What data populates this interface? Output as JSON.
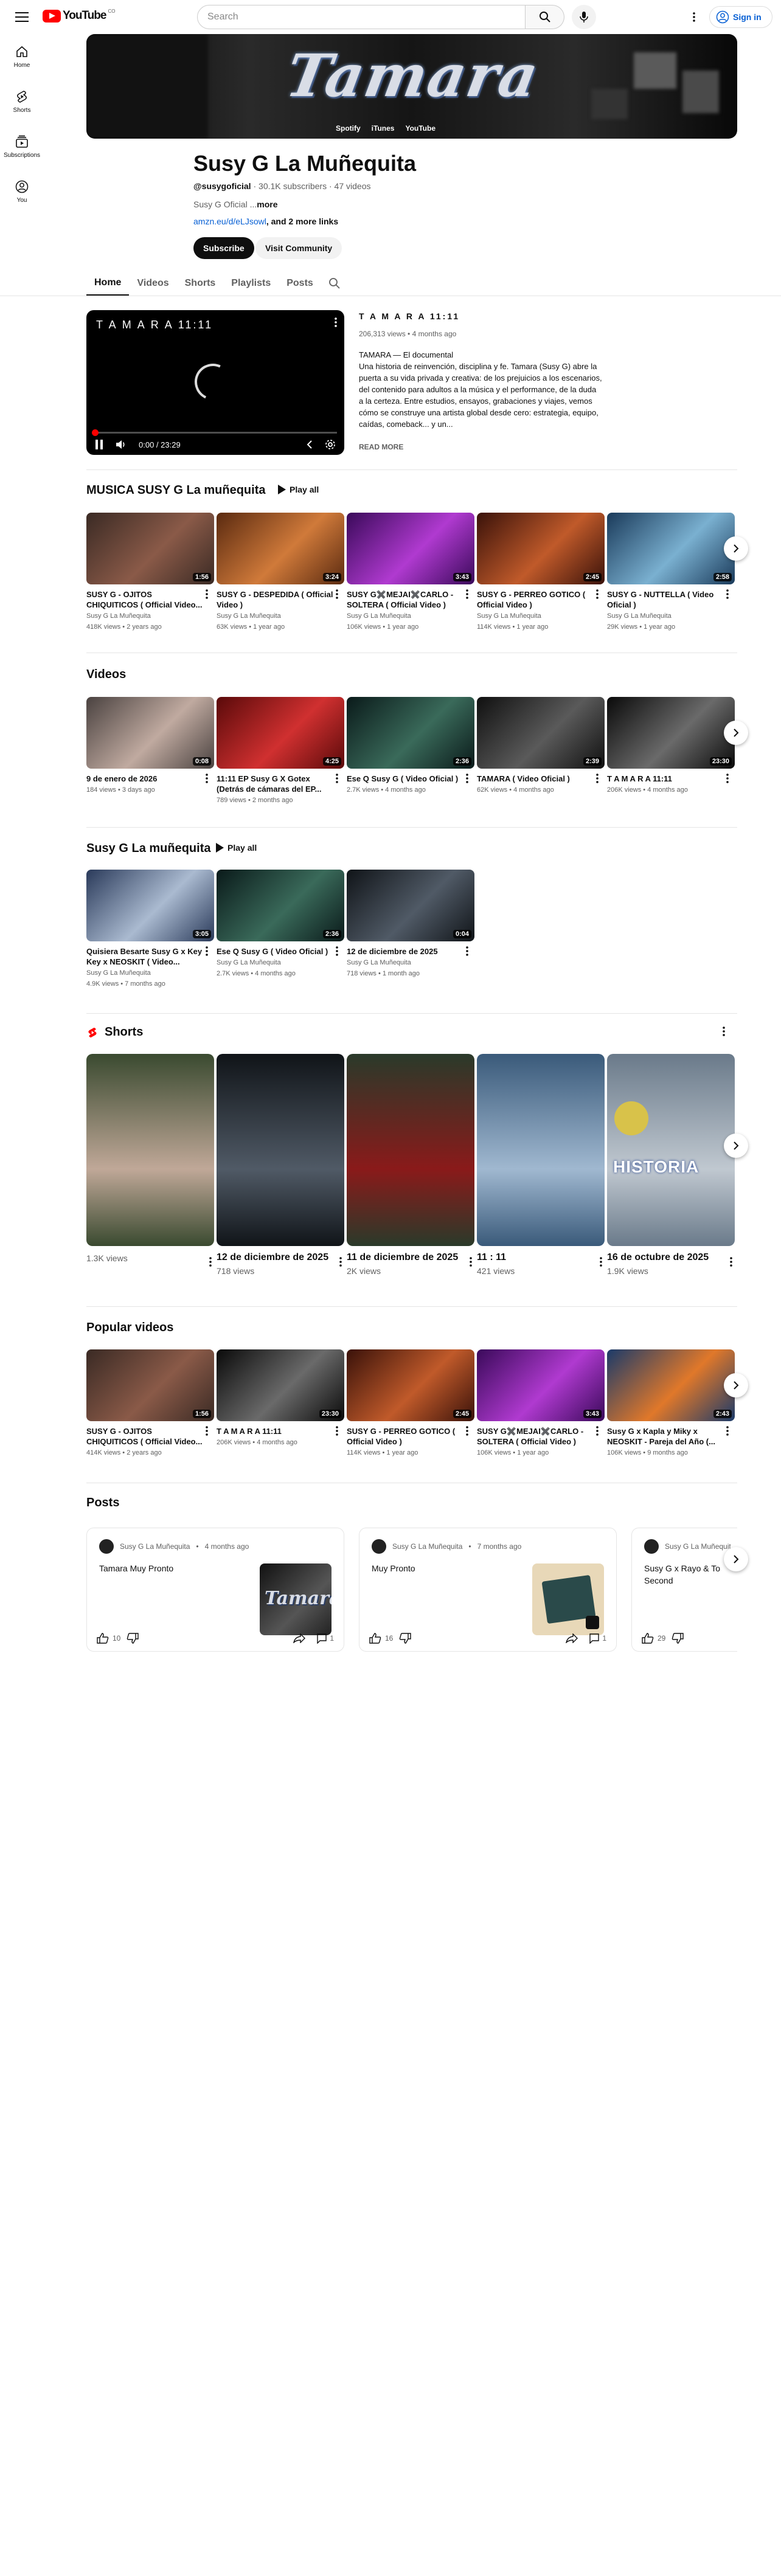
{
  "header": {
    "search_placeholder": "Search",
    "signin_label": "Sign in",
    "logo_text": "YouTube",
    "logo_country": "CO"
  },
  "sidebar": {
    "items": [
      {
        "label": "Home",
        "icon": "home-icon"
      },
      {
        "label": "Shorts",
        "icon": "shorts-icon"
      },
      {
        "label": "Subscriptions",
        "icon": "subscriptions-icon"
      },
      {
        "label": "You",
        "icon": "you-icon"
      }
    ]
  },
  "banner": {
    "title_art": "Tamara",
    "brands": [
      "Spotify",
      "iTunes",
      "YouTube"
    ]
  },
  "channel": {
    "name": "Susy  G La Muñequita",
    "handle": "@susygoficial",
    "subscribers": "30.1K subscribers",
    "videos": "47 videos",
    "description": "Susy G Oficial ...",
    "desc_more": "more",
    "link": "amzn.eu/d/eLJsowl",
    "link_more": ", and 2 more links",
    "subscribe_label": "Subscribe",
    "community_label": "Visit Community"
  },
  "tabs": [
    "Home",
    "Videos",
    "Shorts",
    "Playlists",
    "Posts"
  ],
  "featured": {
    "player_title": "T A M A R A 11:11",
    "time": "0:00 / 23:29",
    "title": "T A M A R A 11:11",
    "meta": "206,313 views • 4 months ago",
    "description": " TAMARA — El documental\nUna historia de reinvención, disciplina y fe. Tamara (Susy G) abre la puerta a su vida privada y creativa: de los prejuicios a los escenarios, del contenido para adultos a la música y el performance, de la duda a la certeza. Entre estudios, ensayos, grabaciones y viajes, vemos cómo se construye una artista global desde cero: estrategia, equipo, caídas, comeback... y un...",
    "read_more": "READ MORE"
  },
  "section_music": {
    "title": "MUSICA SUSY G La muñequita",
    "play_all": "Play all",
    "cards": [
      {
        "title": "SUSY G - OJITOS CHIQUITICOS ( Official Video...",
        "channel": "Susy  G La Muñequita",
        "meta": "418K views • 2 years ago",
        "dur": "1:56",
        "c1": "#3a2a24",
        "c2": "#8a5a48"
      },
      {
        "title": "SUSY G - DESPEDIDA ( Official Video )",
        "channel": "Susy  G La Muñequita",
        "meta": "63K views • 1 year ago",
        "dur": "3:24",
        "c1": "#5a2a10",
        "c2": "#d07a3a"
      },
      {
        "title": "SUSY G✖️MEJAI✖️CARLO - SOLTERA ( Official Video )",
        "channel": "Susy  G La Muñequita",
        "meta": "106K views • 1 year ago",
        "dur": "3:43",
        "c1": "#3a0a5a",
        "c2": "#b03ad0"
      },
      {
        "title": "SUSY G - PERREO GOTICO ( Official Video )",
        "channel": "Susy  G La Muñequita",
        "meta": "114K views • 1 year ago",
        "dur": "2:45",
        "c1": "#3a120a",
        "c2": "#c05a2a"
      },
      {
        "title": "SUSY G - NUTTELLA ( Video Oficial )",
        "channel": "Susy  G La Muñequita",
        "meta": "29K views • 1 year ago",
        "dur": "2:58",
        "c1": "#1a3a5a",
        "c2": "#7ab0d0"
      }
    ]
  },
  "section_videos": {
    "title": "Videos",
    "cards": [
      {
        "title": "9 de enero de 2026",
        "meta": "184 views • 3 days ago",
        "dur": "0:08",
        "c1": "#4a4240",
        "c2": "#c0aaa0"
      },
      {
        "title": "11:11 EP Susy G X Gotex (Detrás de cámaras  del EP...",
        "meta": "789 views • 2 months ago",
        "dur": "4:25",
        "c1": "#5a0a0a",
        "c2": "#d03030"
      },
      {
        "title": "Ese Q Susy G ( Video Oficial )",
        "meta": "2.7K views • 4 months ago",
        "dur": "2:36",
        "c1": "#0a1a1a",
        "c2": "#3a6a5a"
      },
      {
        "title": "TAMARA ( Video Oficial )",
        "meta": "62K views • 4 months ago",
        "dur": "2:39",
        "c1": "#101010",
        "c2": "#5a5a5a"
      },
      {
        "title": "T A M A R A 11:11",
        "meta": "206K views • 4 months ago",
        "dur": "23:30",
        "c1": "#0a0a0a",
        "c2": "#6a6a6a"
      }
    ]
  },
  "section_playlist": {
    "title": "Susy G La muñequita",
    "play_all": "Play all",
    "cards": [
      {
        "title": "Quisiera Besarte Susy G x Key Key x NEOSKIT ( Video...",
        "channel": "Susy  G La Muñequita",
        "meta": "4.9K views • 7 months ago",
        "dur": "3:05",
        "c1": "#2a3a5a",
        "c2": "#aabad0"
      },
      {
        "title": "Ese Q Susy G ( Video Oficial )",
        "channel": "Susy  G La Muñequita",
        "meta": "2.7K views • 4 months ago",
        "dur": "2:36",
        "c1": "#0a1a1a",
        "c2": "#3a6a5a"
      },
      {
        "title": "12 de diciembre de 2025",
        "channel": "Susy  G La Muñequita",
        "meta": "718 views • 1 month ago",
        "dur": "0:04",
        "c1": "#101418",
        "c2": "#505a66"
      }
    ]
  },
  "section_shorts": {
    "title": "Shorts",
    "items": [
      {
        "title": "",
        "views": "1.3K views",
        "c1": "#3a4a30",
        "c2": "#c0a898"
      },
      {
        "title": "12 de diciembre de 2025",
        "views": "718 views",
        "c1": "#101418",
        "c2": "#505a66"
      },
      {
        "title": "11 de diciembre de 2025",
        "views": "2K views",
        "c1": "#2a3a2a",
        "c2": "#8a1a1a"
      },
      {
        "title": "11 : 11 ",
        "views": "421 views",
        "c1": "#3a5a7a",
        "c2": "#a0b8d0"
      },
      {
        "title": "16 de octubre de 2025",
        "views": "1.9K views",
        "c1": "#6a7a8a",
        "c2": "#c0c8d0"
      }
    ],
    "badge": "HISTORIA"
  },
  "section_popular": {
    "title": "Popular videos",
    "cards": [
      {
        "title": "SUSY G - OJITOS CHIQUITICOS ( Official Video...",
        "meta": "414K views • 2 years ago",
        "dur": "1:56",
        "c1": "#3a2a24",
        "c2": "#8a5a48"
      },
      {
        "title": "T A M A R A 11:11",
        "meta": "206K views • 4 months ago",
        "dur": "23:30",
        "c1": "#0a0a0a",
        "c2": "#6a6a6a"
      },
      {
        "title": "SUSY G - PERREO GOTICO ( Official Video )",
        "meta": "114K views • 1 year ago",
        "dur": "2:45",
        "c1": "#3a120a",
        "c2": "#c05a2a"
      },
      {
        "title": "SUSY G✖️MEJAI✖️CARLO - SOLTERA ( Official Video )",
        "meta": "106K views • 1 year ago",
        "dur": "3:43",
        "c1": "#3a0a5a",
        "c2": "#b03ad0"
      },
      {
        "title": "Susy G x Kapla y Miky x NEOSKIT - Pareja del Año (...",
        "meta": "106K views • 9 months ago",
        "dur": "2:43",
        "c1": "#1a3a6a",
        "c2": "#e0782a"
      }
    ]
  },
  "section_posts": {
    "title": "Posts",
    "posts": [
      {
        "author": "Susy  G La Muñequita",
        "time": "4 months ago",
        "text": "Tamara Muy Pronto",
        "likes": "10",
        "comments": "1"
      },
      {
        "author": "Susy  G La Muñequita",
        "time": "7 months ago",
        "text": "Muy Pronto",
        "likes": "16",
        "comments": "1"
      },
      {
        "author": "Susy  G La Muñequit",
        "time": "",
        "text": "Susy G x Rayo & To Second",
        "likes": "29",
        "comments": ""
      }
    ]
  },
  "colors": {
    "accent": "#ff0000",
    "link": "#065fd4",
    "text": "#0f0f0f",
    "muted": "#606060"
  }
}
